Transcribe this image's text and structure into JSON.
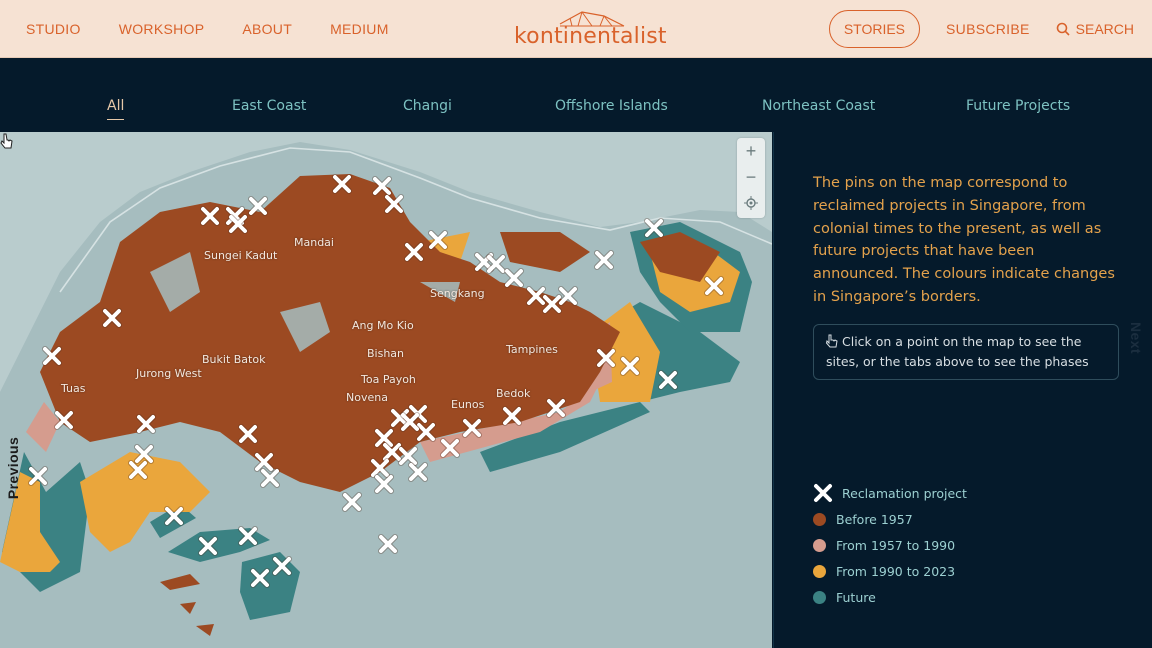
{
  "nav": {
    "left": [
      "STUDIO",
      "WORKSHOP",
      "ABOUT",
      "MEDIUM"
    ],
    "right": [
      "STORIES",
      "SUBSCRIBE"
    ],
    "search": "SEARCH",
    "logo": "kontinentalist"
  },
  "tabs": [
    "All",
    "East Coast",
    "Changi",
    "Offshore Islands",
    "Northeast Coast",
    "Future Projects"
  ],
  "active_tab": "All",
  "map": {
    "places": [
      "Mandai",
      "Sungei Kadut",
      "Sengkang",
      "Ang Mo Kio",
      "Bishan",
      "Bukit Batok",
      "Jurong West",
      "Toa Payoh",
      "Tampines",
      "Novena",
      "Bedok",
      "Eunos",
      "Tuas"
    ],
    "zoom_in": "+",
    "zoom_out": "−",
    "prev_label": "Previous",
    "next_label": "Next"
  },
  "panel": {
    "intro": "The pins on the map correspond to reclaimed projects in Singapore, from colonial times to the present, as well as future projects that have been announced. The colours indicate changes in Singapore’s borders.",
    "hint": "Click on a point on the map to see the sites, or the tabs above to see the phases",
    "legend": [
      {
        "label": "Reclamation project",
        "kind": "pin"
      },
      {
        "label": "Before 1957",
        "color": "#9c4a22"
      },
      {
        "label": "From 1957 to 1990",
        "color": "#d59c8e"
      },
      {
        "label": "From 1990 to 2023",
        "color": "#eaa63c"
      },
      {
        "label": "Future",
        "color": "#3b8283"
      }
    ]
  },
  "colors": {
    "land": "#9c4a22",
    "mid": "#d59c8e",
    "recent": "#eaa63c",
    "future": "#3b8283",
    "sea": "#a6bdbf",
    "accent": "#d9622b"
  }
}
